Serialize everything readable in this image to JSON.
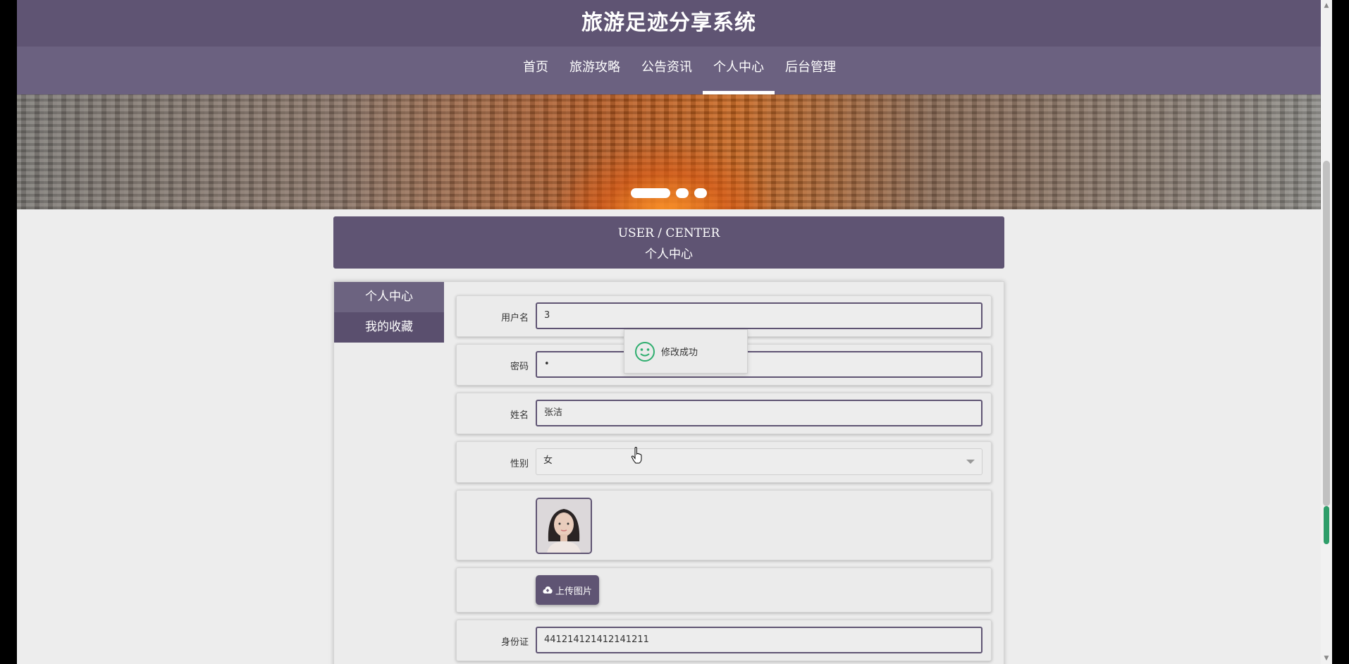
{
  "site": {
    "title": "旅游足迹分享系统"
  },
  "nav": {
    "items": [
      {
        "label": "首页",
        "active": false
      },
      {
        "label": "旅游攻略",
        "active": false
      },
      {
        "label": "公告资讯",
        "active": false
      },
      {
        "label": "个人中心",
        "active": true
      },
      {
        "label": "后台管理",
        "active": false
      }
    ]
  },
  "banner": {
    "slides": 3,
    "active_slide": 0
  },
  "center_header": {
    "en": "USER / CENTER",
    "cn": "个人中心"
  },
  "side_menu": {
    "items": [
      {
        "label": "个人中心",
        "active": true
      },
      {
        "label": "我的收藏",
        "active": false
      }
    ]
  },
  "form": {
    "username": {
      "label": "用户名",
      "value": "3"
    },
    "password": {
      "label": "密码",
      "value": "•"
    },
    "name": {
      "label": "姓名",
      "value": "张洁"
    },
    "gender": {
      "label": "性别",
      "value": "女"
    },
    "upload": {
      "label": "上传图片"
    },
    "id_card": {
      "label": "身份证",
      "value": "441214121412141211"
    }
  },
  "toast": {
    "message": "修改成功"
  },
  "colors": {
    "primary": "#5f5473",
    "nav": "#6b6180",
    "success": "#2fae6f"
  }
}
